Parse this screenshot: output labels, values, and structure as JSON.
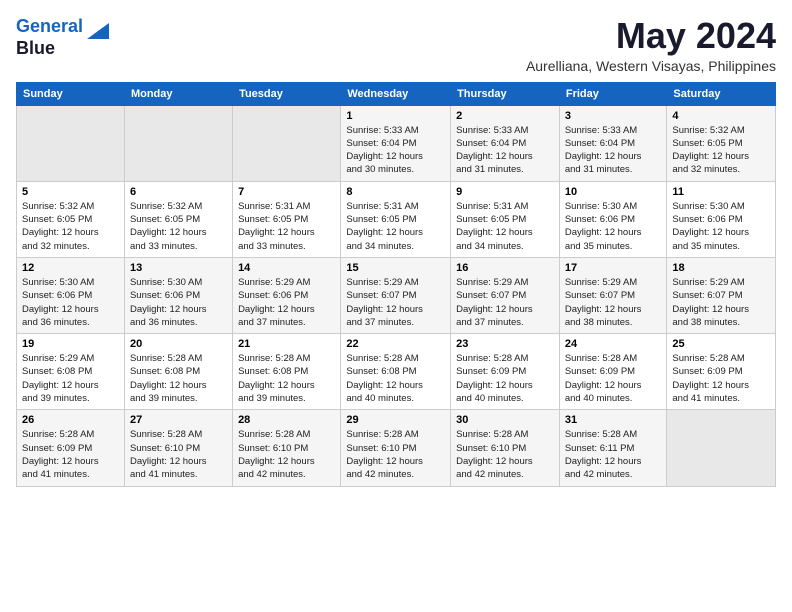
{
  "header": {
    "logo_line1": "General",
    "logo_line2": "Blue",
    "month": "May 2024",
    "location": "Aurelliana, Western Visayas, Philippines"
  },
  "days_of_week": [
    "Sunday",
    "Monday",
    "Tuesday",
    "Wednesday",
    "Thursday",
    "Friday",
    "Saturday"
  ],
  "weeks": [
    [
      {
        "num": "",
        "info": ""
      },
      {
        "num": "",
        "info": ""
      },
      {
        "num": "",
        "info": ""
      },
      {
        "num": "1",
        "info": "Sunrise: 5:33 AM\nSunset: 6:04 PM\nDaylight: 12 hours\nand 30 minutes."
      },
      {
        "num": "2",
        "info": "Sunrise: 5:33 AM\nSunset: 6:04 PM\nDaylight: 12 hours\nand 31 minutes."
      },
      {
        "num": "3",
        "info": "Sunrise: 5:33 AM\nSunset: 6:04 PM\nDaylight: 12 hours\nand 31 minutes."
      },
      {
        "num": "4",
        "info": "Sunrise: 5:32 AM\nSunset: 6:05 PM\nDaylight: 12 hours\nand 32 minutes."
      }
    ],
    [
      {
        "num": "5",
        "info": "Sunrise: 5:32 AM\nSunset: 6:05 PM\nDaylight: 12 hours\nand 32 minutes."
      },
      {
        "num": "6",
        "info": "Sunrise: 5:32 AM\nSunset: 6:05 PM\nDaylight: 12 hours\nand 33 minutes."
      },
      {
        "num": "7",
        "info": "Sunrise: 5:31 AM\nSunset: 6:05 PM\nDaylight: 12 hours\nand 33 minutes."
      },
      {
        "num": "8",
        "info": "Sunrise: 5:31 AM\nSunset: 6:05 PM\nDaylight: 12 hours\nand 34 minutes."
      },
      {
        "num": "9",
        "info": "Sunrise: 5:31 AM\nSunset: 6:05 PM\nDaylight: 12 hours\nand 34 minutes."
      },
      {
        "num": "10",
        "info": "Sunrise: 5:30 AM\nSunset: 6:06 PM\nDaylight: 12 hours\nand 35 minutes."
      },
      {
        "num": "11",
        "info": "Sunrise: 5:30 AM\nSunset: 6:06 PM\nDaylight: 12 hours\nand 35 minutes."
      }
    ],
    [
      {
        "num": "12",
        "info": "Sunrise: 5:30 AM\nSunset: 6:06 PM\nDaylight: 12 hours\nand 36 minutes."
      },
      {
        "num": "13",
        "info": "Sunrise: 5:30 AM\nSunset: 6:06 PM\nDaylight: 12 hours\nand 36 minutes."
      },
      {
        "num": "14",
        "info": "Sunrise: 5:29 AM\nSunset: 6:06 PM\nDaylight: 12 hours\nand 37 minutes."
      },
      {
        "num": "15",
        "info": "Sunrise: 5:29 AM\nSunset: 6:07 PM\nDaylight: 12 hours\nand 37 minutes."
      },
      {
        "num": "16",
        "info": "Sunrise: 5:29 AM\nSunset: 6:07 PM\nDaylight: 12 hours\nand 37 minutes."
      },
      {
        "num": "17",
        "info": "Sunrise: 5:29 AM\nSunset: 6:07 PM\nDaylight: 12 hours\nand 38 minutes."
      },
      {
        "num": "18",
        "info": "Sunrise: 5:29 AM\nSunset: 6:07 PM\nDaylight: 12 hours\nand 38 minutes."
      }
    ],
    [
      {
        "num": "19",
        "info": "Sunrise: 5:29 AM\nSunset: 6:08 PM\nDaylight: 12 hours\nand 39 minutes."
      },
      {
        "num": "20",
        "info": "Sunrise: 5:28 AM\nSunset: 6:08 PM\nDaylight: 12 hours\nand 39 minutes."
      },
      {
        "num": "21",
        "info": "Sunrise: 5:28 AM\nSunset: 6:08 PM\nDaylight: 12 hours\nand 39 minutes."
      },
      {
        "num": "22",
        "info": "Sunrise: 5:28 AM\nSunset: 6:08 PM\nDaylight: 12 hours\nand 40 minutes."
      },
      {
        "num": "23",
        "info": "Sunrise: 5:28 AM\nSunset: 6:09 PM\nDaylight: 12 hours\nand 40 minutes."
      },
      {
        "num": "24",
        "info": "Sunrise: 5:28 AM\nSunset: 6:09 PM\nDaylight: 12 hours\nand 40 minutes."
      },
      {
        "num": "25",
        "info": "Sunrise: 5:28 AM\nSunset: 6:09 PM\nDaylight: 12 hours\nand 41 minutes."
      }
    ],
    [
      {
        "num": "26",
        "info": "Sunrise: 5:28 AM\nSunset: 6:09 PM\nDaylight: 12 hours\nand 41 minutes."
      },
      {
        "num": "27",
        "info": "Sunrise: 5:28 AM\nSunset: 6:10 PM\nDaylight: 12 hours\nand 41 minutes."
      },
      {
        "num": "28",
        "info": "Sunrise: 5:28 AM\nSunset: 6:10 PM\nDaylight: 12 hours\nand 42 minutes."
      },
      {
        "num": "29",
        "info": "Sunrise: 5:28 AM\nSunset: 6:10 PM\nDaylight: 12 hours\nand 42 minutes."
      },
      {
        "num": "30",
        "info": "Sunrise: 5:28 AM\nSunset: 6:10 PM\nDaylight: 12 hours\nand 42 minutes."
      },
      {
        "num": "31",
        "info": "Sunrise: 5:28 AM\nSunset: 6:11 PM\nDaylight: 12 hours\nand 42 minutes."
      },
      {
        "num": "",
        "info": ""
      }
    ]
  ]
}
